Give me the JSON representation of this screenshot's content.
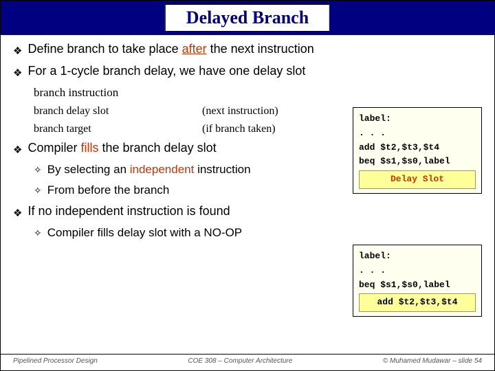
{
  "title": "Delayed Branch",
  "bullets": {
    "b1_pre": "Define branch to take place ",
    "b1_after": "after",
    "b1_post": " the next instruction",
    "b2": "For a 1-cycle branch delay, we have one delay slot",
    "b3_pre": "Compiler ",
    "b3_fills": "fills",
    "b3_post": " the branch delay slot",
    "b4": "If no independent instruction is found"
  },
  "subs": {
    "s1": "branch instruction",
    "s2a": "branch delay slot",
    "s2b": "(next instruction)",
    "s3a": "branch target",
    "s3b": "(if branch taken)",
    "h1_pre": "By selecting an ",
    "h1_red": "independent",
    "h1_post": " instruction",
    "h2": "From before the branch",
    "h3": "Compiler fills delay slot with a NO-OP"
  },
  "code1": {
    "l1": "label:",
    "l2": ". . .",
    "l3": "add $t2,$t3,$t4",
    "l4": "beq $s1,$s0,label",
    "slot": "Delay Slot"
  },
  "code2": {
    "l1": "label:",
    "l2": ". . .",
    "l3": "beq $s1,$s0,label",
    "hl": "add $t2,$t3,$t4"
  },
  "footer": {
    "left": "Pipelined Processor Design",
    "mid": "COE 308 – Computer Architecture",
    "right": "© Muhamed Mudawar – slide 54"
  }
}
